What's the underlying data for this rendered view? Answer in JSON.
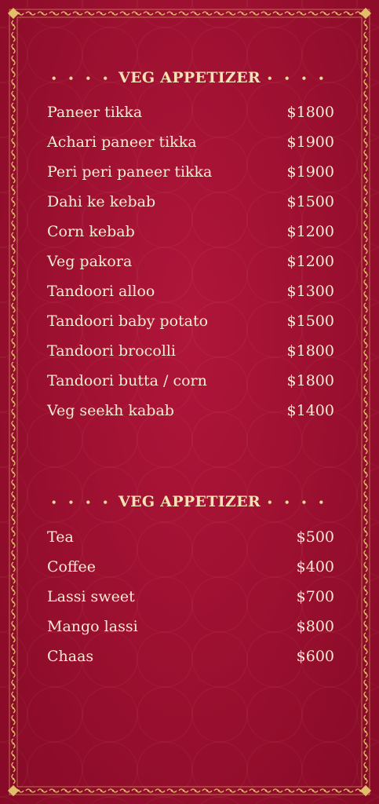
{
  "sections": [
    {
      "title": "VEG APPETIZER",
      "items": [
        {
          "name": "Paneer tikka",
          "price": "$1800"
        },
        {
          "name": "Achari paneer tikka",
          "price": "$1900"
        },
        {
          "name": "Peri peri paneer tikka",
          "price": "$1900"
        },
        {
          "name": "Dahi ke kebab",
          "price": "$1500"
        },
        {
          "name": "Corn kebab",
          "price": "$1200"
        },
        {
          "name": "Veg pakora",
          "price": "$1200"
        },
        {
          "name": "Tandoori alloo",
          "price": "$1300"
        },
        {
          "name": "Tandoori baby potato",
          "price": "$1500"
        },
        {
          "name": "Tandoori brocolli",
          "price": "$1800"
        },
        {
          "name": "Tandoori butta / corn",
          "price": "$1800"
        },
        {
          "name": "Veg seekh kabab",
          "price": "$1400"
        }
      ]
    },
    {
      "title": "VEG APPETIZER",
      "items": [
        {
          "name": "Tea",
          "price": "$500"
        },
        {
          "name": "Coffee",
          "price": "$400"
        },
        {
          "name": "Lassi sweet",
          "price": "$700"
        },
        {
          "name": "Mango lassi",
          "price": "$800"
        },
        {
          "name": "Chaas",
          "price": "$600"
        }
      ]
    }
  ],
  "colors": {
    "background": "#9a0f2f",
    "gold": "#e2bd6a",
    "text": "#f7ecd2"
  },
  "decoration": {
    "title_dots": "• • • •"
  }
}
